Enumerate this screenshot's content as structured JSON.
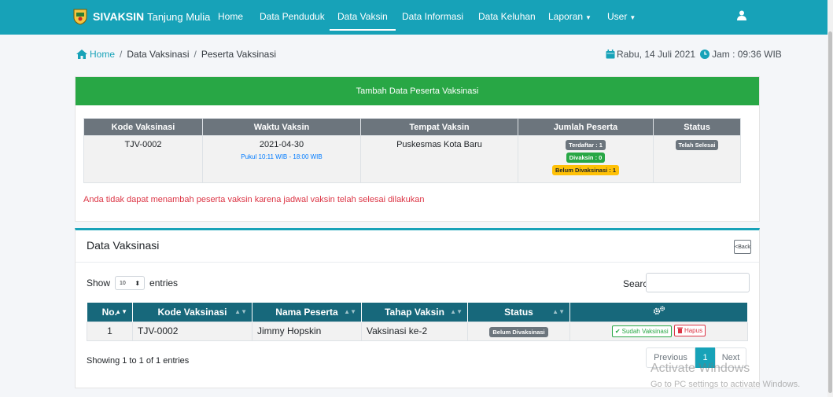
{
  "brand": {
    "name_bold": "SIVAKSIN",
    "name_rest": "Tanjung Mulia"
  },
  "nav": {
    "home": "Home",
    "penduduk": "Data Penduduk",
    "vaksin": "Data Vaksin",
    "informasi": "Data Informasi",
    "keluhan": "Data Keluhan",
    "laporan": "Laporan",
    "user": "User"
  },
  "breadcrumb": {
    "home": "Home",
    "level2": "Data Vaksinasi",
    "level3": "Peserta Vaksinasi"
  },
  "datetime": {
    "date": "Rabu, 14 Juli 2021",
    "time": "Jam : 09:36 WIB"
  },
  "add_card": {
    "title": "Tambah Data Peserta Vaksinasi",
    "headers": [
      "Kode Vaksinasi",
      "Waktu Vaksin",
      "Tempat Vaksin",
      "Jumlah Peserta",
      "Status"
    ],
    "row": {
      "kode": "TJV-0002",
      "tanggal": "2021-04-30",
      "jam": "Pukul 10:11 WIB - 18:00 WIB",
      "tempat": "Puskesmas Kota Baru",
      "terdaftar": "Terdaftar : 1",
      "divaksin": "Divaksin : 0",
      "belum": "Belum Divaksinasi : 1",
      "status": "Telah Selesai"
    },
    "warning": "Anda tidak dapat menambah peserta vaksin karena jadwal vaksin telah selesai dilakukan"
  },
  "list_card": {
    "title": "Data Vaksinasi",
    "back": "Back",
    "show_label": "Show",
    "entries_value": "10",
    "entries_label": "entries",
    "search_label": "Search:",
    "headers": [
      "No.",
      "Kode Vaksinasi",
      "Nama Peserta",
      "Tahap Vaksin",
      "Status"
    ],
    "rows": [
      {
        "no": "1",
        "kode": "TJV-0002",
        "nama": "Jimmy Hopskin",
        "tahap": "Vaksinasi ke-2",
        "status": "Belum Divaksinasi",
        "btn_done": "Sudah Vaksinasi",
        "btn_delete": "Hapus"
      }
    ],
    "showing": "Showing 1 to 1 of 1 entries",
    "pagination": {
      "prev": "Previous",
      "current": "1",
      "next": "Next"
    }
  },
  "watermark": {
    "line1": "Activate Windows",
    "line2": "Go to PC settings to activate Windows."
  },
  "icons": {
    "logo": "regional-emblem-icon",
    "user": "user-icon",
    "home": "home-icon",
    "calendar": "calendar-icon",
    "clock": "clock-icon",
    "actions": "gears-icon",
    "check": "check-icon",
    "trash": "trash-icon",
    "sort": "sort-icon"
  },
  "colors": {
    "navbar": "#17a2b8",
    "header_green": "#28a745",
    "table_head": "#17687b",
    "danger": "#dc3545"
  }
}
